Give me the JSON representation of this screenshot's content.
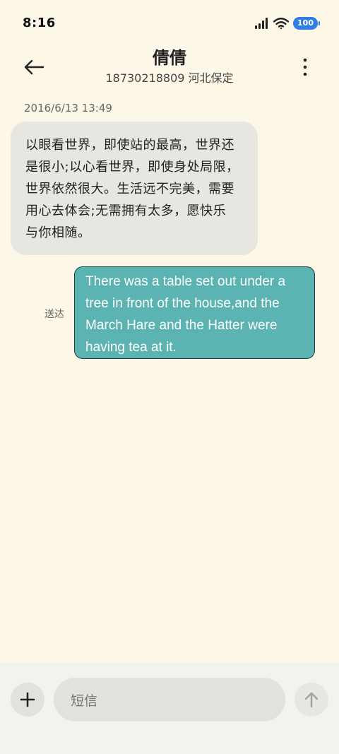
{
  "status_bar": {
    "time": "8:16",
    "battery": "100",
    "icons": [
      "signal-icon",
      "wifi-icon",
      "battery-icon"
    ]
  },
  "header": {
    "contact_name": "倩倩",
    "contact_detail": "18730218809 河北保定",
    "back_icon": "arrow-left-icon",
    "more_icon": "more-vertical-icon"
  },
  "conversation": {
    "timestamp": "2016/6/13 13:49",
    "received_message": {
      "lines": [
        "以眼看世界，即使站的最高，世界还",
        "是很小;以心看世界，即使身处局限，",
        "世界依然很大。生活远不完美，需要",
        "用心去体会;无需拥有太多，愿快乐",
        "与你相随。"
      ]
    },
    "sent_message": {
      "lines": [
        "There was a table set out under a",
        "tree in front of the house,and the",
        "March Hare and the Hatter were",
        "having tea at it."
      ],
      "status": "送达"
    }
  },
  "composer": {
    "placeholder": "短信",
    "add_icon": "plus-icon",
    "send_icon": "arrow-up-icon"
  },
  "colors": {
    "background": "#FCF7E6",
    "received_bubble": "#E8E6E1",
    "sent_bubble": "#5BB4B1",
    "battery": "#2F7FE7"
  }
}
